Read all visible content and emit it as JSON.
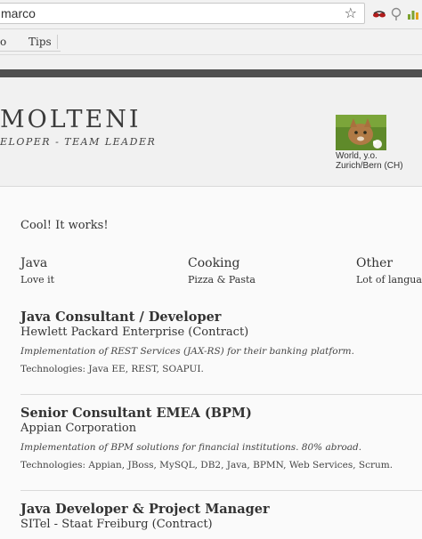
{
  "browser": {
    "url": "marco",
    "bookmarks": [
      "o",
      "Tips"
    ]
  },
  "header": {
    "name": "MOLTENI",
    "role": "ELOPER - TEAM LEADER",
    "location_line1": "World, y.o.",
    "location_line2": "Zurich/Bern (CH)"
  },
  "status": "Cool! It works!",
  "skills": [
    {
      "title": "Java",
      "subtitle": "Love it"
    },
    {
      "title": "Cooking",
      "subtitle": "Pizza & Pasta"
    },
    {
      "title": "Other",
      "subtitle": "Lot of languages"
    }
  ],
  "jobs": [
    {
      "title": "Java Consultant / Developer",
      "company": "Hewlett Packard Enterprise (Contract)",
      "description": "Implementation of REST Services (JAX-RS) for their banking platform.",
      "technologies": "Technologies: Java EE, REST, SOAPUI."
    },
    {
      "title": "Senior Consultant EMEA (BPM)",
      "company": "Appian Corporation",
      "description": "Implementation of BPM solutions for financial institutions. 80% abroad.",
      "technologies": "Technologies: Appian, JBoss, MySQL, DB2, Java, BPMN, Web Services, Scrum."
    },
    {
      "title": "Java Developer & Project Manager",
      "company": "SITel - Staat Freiburg (Contract)"
    }
  ]
}
